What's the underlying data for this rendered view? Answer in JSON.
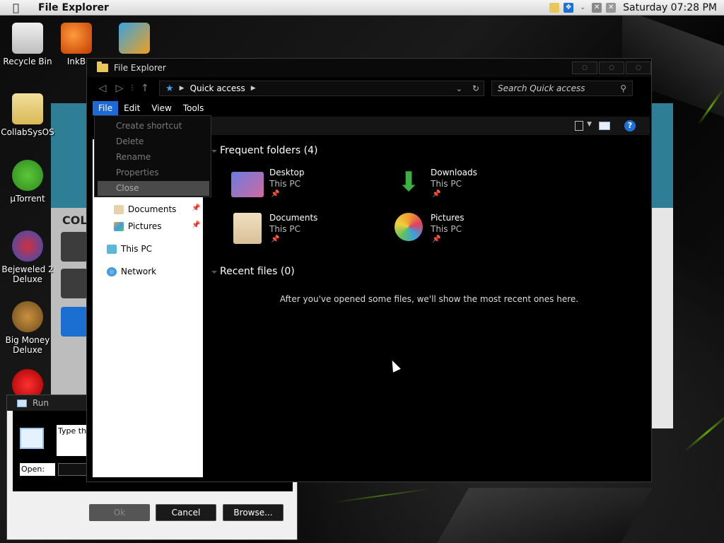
{
  "menubar": {
    "app_title": "File Explorer",
    "clock": "Saturday 07:28 PM"
  },
  "desktop": {
    "icons": [
      {
        "label": "Recycle Bin"
      },
      {
        "label": "InkB"
      },
      {
        "label": "CollabSysOS"
      },
      {
        "label": "µTorrent"
      },
      {
        "label": "Bejeweled 2 Deluxe"
      },
      {
        "label": "Big Money Deluxe"
      }
    ]
  },
  "bgapp": {
    "title": "COL"
  },
  "run": {
    "title": "Run",
    "desc": "Type the resource",
    "open_label": "Open:",
    "ok": "Ok",
    "cancel": "Cancel",
    "browse": "Browse..."
  },
  "explorer": {
    "title": "File Explorer",
    "address": "Quick access",
    "search_placeholder": "Search Quick access",
    "menu": [
      "File",
      "Edit",
      "View",
      "Tools"
    ],
    "file_menu": [
      "Create shortcut",
      "Delete",
      "Rename",
      "Properties",
      "Close"
    ],
    "nav": {
      "documents": "Documents",
      "pictures": "Pictures",
      "this_pc": "This PC",
      "network": "Network"
    },
    "frequent_header": "Frequent folders (4)",
    "folders": [
      {
        "name": "Desktop",
        "location": "This PC"
      },
      {
        "name": "Downloads",
        "location": "This PC"
      },
      {
        "name": "Documents",
        "location": "This PC"
      },
      {
        "name": "Pictures",
        "location": "This PC"
      }
    ],
    "recent_header": "Recent files (0)",
    "recent_empty": "After you've opened some files, we'll show the most recent ones here."
  },
  "colors": {
    "accent": "#1c6ad6",
    "wallpaper_streak": "#7cd100"
  }
}
